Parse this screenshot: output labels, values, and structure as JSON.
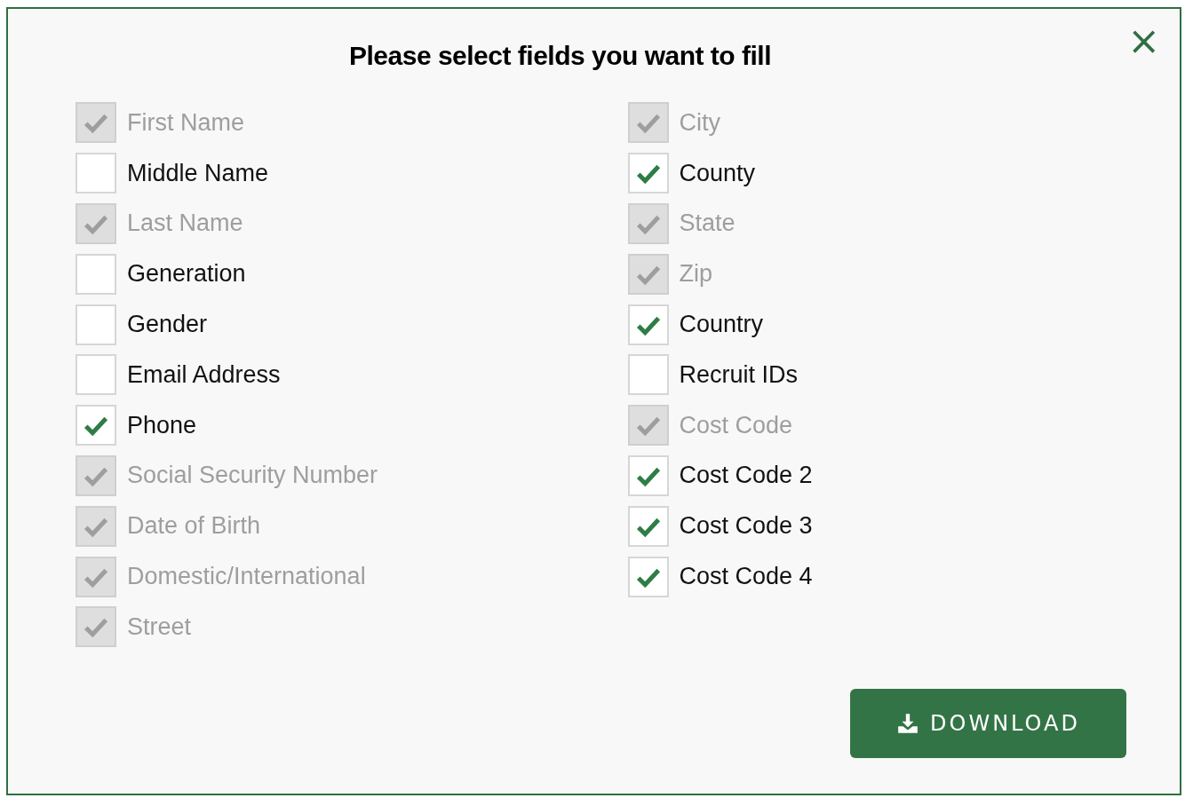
{
  "dialog": {
    "title": "Please select fields you want to fill",
    "close": "×"
  },
  "columns": [
    [
      {
        "label": "First Name",
        "checked": true,
        "disabled": true
      },
      {
        "label": "Middle Name",
        "checked": false,
        "disabled": false
      },
      {
        "label": "Last Name",
        "checked": true,
        "disabled": true
      },
      {
        "label": "Generation",
        "checked": false,
        "disabled": false
      },
      {
        "label": "Gender",
        "checked": false,
        "disabled": false
      },
      {
        "label": "Email Address",
        "checked": false,
        "disabled": false
      },
      {
        "label": "Phone",
        "checked": true,
        "disabled": false
      },
      {
        "label": "Social Security Number",
        "checked": true,
        "disabled": true
      },
      {
        "label": "Date of Birth",
        "checked": true,
        "disabled": true
      },
      {
        "label": "Domestic/International",
        "checked": true,
        "disabled": true
      },
      {
        "label": "Street",
        "checked": true,
        "disabled": true
      }
    ],
    [
      {
        "label": "City",
        "checked": true,
        "disabled": true
      },
      {
        "label": "County",
        "checked": true,
        "disabled": false
      },
      {
        "label": "State",
        "checked": true,
        "disabled": true
      },
      {
        "label": "Zip",
        "checked": true,
        "disabled": true
      },
      {
        "label": "Country",
        "checked": true,
        "disabled": false
      },
      {
        "label": "Recruit IDs",
        "checked": false,
        "disabled": false
      },
      {
        "label": "Cost Code",
        "checked": true,
        "disabled": true
      },
      {
        "label": "Cost Code 2",
        "checked": true,
        "disabled": false
      },
      {
        "label": "Cost Code 3",
        "checked": true,
        "disabled": false
      },
      {
        "label": "Cost Code 4",
        "checked": true,
        "disabled": false
      }
    ]
  ],
  "download_button": {
    "label": "DOWNLOAD"
  }
}
